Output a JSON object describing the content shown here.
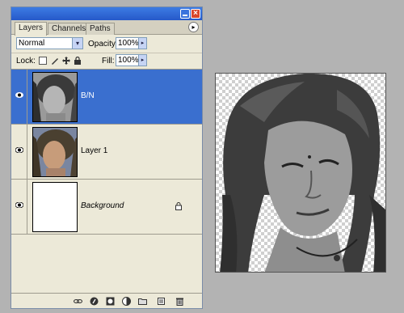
{
  "palette": {
    "tabs": [
      {
        "label": "Layers",
        "active": true
      },
      {
        "label": "Channels",
        "active": false
      },
      {
        "label": "Paths",
        "active": false
      }
    ],
    "close_glyph": "×",
    "menu_glyph": "▸",
    "blend_mode": "Normal",
    "dropdown_glyph": "▾",
    "opacity_label": "Opacity:",
    "opacity_value": "100%",
    "fill_label": "Fill:",
    "fill_value": "100%",
    "lock_label": "Lock:",
    "stepper_glyph": "▸",
    "layers": [
      {
        "name": "B/N",
        "selected": true,
        "visible": true,
        "thumb": "grayscale-portrait",
        "locked": false
      },
      {
        "name": "Layer 1",
        "selected": false,
        "visible": true,
        "thumb": "color-portrait",
        "locked": false
      },
      {
        "name": "Background",
        "selected": false,
        "visible": true,
        "thumb": "white",
        "locked": true,
        "italic": true
      }
    ],
    "bottom_icons": [
      "link-icon",
      "layer-style-icon",
      "mask-icon",
      "adjustment-icon",
      "folder-icon",
      "new-layer-icon",
      "trash-icon"
    ]
  },
  "canvas": {
    "content": "grayscale portrait on transparency checkerboard"
  },
  "colors": {
    "selection": "#3a6fcf",
    "titlebar": "#2f66d6",
    "panel": "#ece9d8"
  }
}
